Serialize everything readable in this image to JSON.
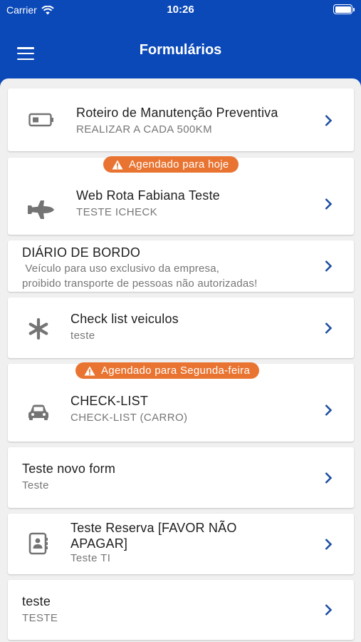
{
  "status_bar": {
    "carrier": "Carrier",
    "time": "10:26"
  },
  "header": {
    "title": "Formulários",
    "menu_icon": "hamburger-menu-icon"
  },
  "colors": {
    "header_bg": "#0b49b8",
    "badge_bg": "#e97431",
    "chevron": "#1e4fa0",
    "icon": "#747474"
  },
  "forms": [
    {
      "title": "Roteiro de Manutenção Preventiva",
      "subtitle": "REALIZAR A CADA 500KM",
      "icon": "battery-icon"
    },
    {
      "badge": "Agendado para hoje",
      "title": "Web Rota Fabiana Teste",
      "subtitle": "TESTE ICHECK",
      "icon": "airplane-icon"
    },
    {
      "title": "DIÁRIO DE BORDO",
      "subtitle": " Veículo para uso exclusivo da empresa,\nproibido transporte de pessoas não autorizadas!"
    },
    {
      "title": "Check list veiculos",
      "subtitle": "teste",
      "icon": "asterisk-icon"
    },
    {
      "badge": "Agendado para Segunda-feira",
      "title": "CHECK-LIST",
      "subtitle": "CHECK-LIST (CARRO)",
      "icon": "car-icon"
    },
    {
      "title": "Teste novo form",
      "subtitle": "Teste"
    },
    {
      "title": "Teste Reserva [FAVOR NÃO APAGAR]",
      "subtitle": "Teste TI",
      "icon": "contact-book-icon"
    },
    {
      "title": "teste",
      "subtitle": "TESTE"
    }
  ]
}
